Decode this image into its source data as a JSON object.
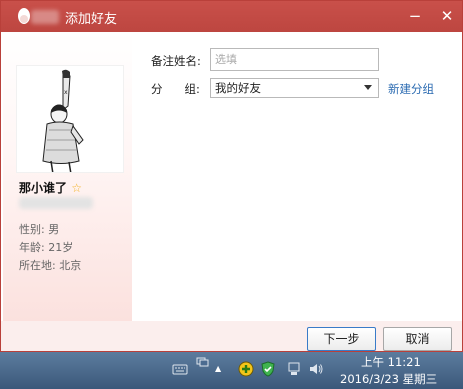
{
  "window": {
    "title": "添加好友",
    "minimize_label": "−",
    "close_label": "✕"
  },
  "profile": {
    "nickname": "那小谁了",
    "star": "☆",
    "gender": "性别: 男",
    "age": "年龄: 21岁",
    "location": "所在地:  北京"
  },
  "form": {
    "remark_label": "备注姓名:",
    "remark_placeholder": "选填",
    "remark_value": "",
    "group_label_left": "分",
    "group_label_right": "组:",
    "group_selected": "我的好友",
    "new_group_link": "新建分组"
  },
  "footer": {
    "next_label": "下一步",
    "cancel_label": "取消"
  },
  "taskbar": {
    "time": "上午 11:21",
    "date": "2016/3/23 星期三"
  },
  "colors": {
    "titlebar": "#c04a44",
    "link": "#2a6ab1",
    "taskbar": "#46648a"
  }
}
